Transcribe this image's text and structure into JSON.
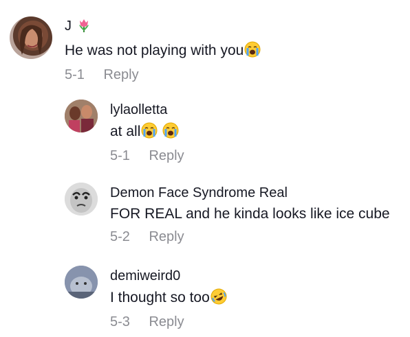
{
  "comments": [
    {
      "username": "J",
      "username_emoji": "tulip-emoji",
      "text": "He was not playing with you",
      "text_emoji_count": 1,
      "date": "5-1",
      "reply_label": "Reply"
    },
    {
      "username": "lylaolletta",
      "text": "at all",
      "text_emoji_count": 2,
      "date": "5-1",
      "reply_label": "Reply"
    },
    {
      "username": "Demon Face Syndrome Real",
      "text": "FOR REAL and he kinda looks like ice cube",
      "date": "5-2",
      "reply_label": "Reply"
    },
    {
      "username": "demiweird0",
      "text": "I thought so too",
      "text_emoji": "rofl-emoji",
      "date": "5-3",
      "reply_label": "Reply"
    }
  ],
  "colors": {
    "text": "#161823",
    "meta": "#8a8b91",
    "background": "#ffffff"
  }
}
